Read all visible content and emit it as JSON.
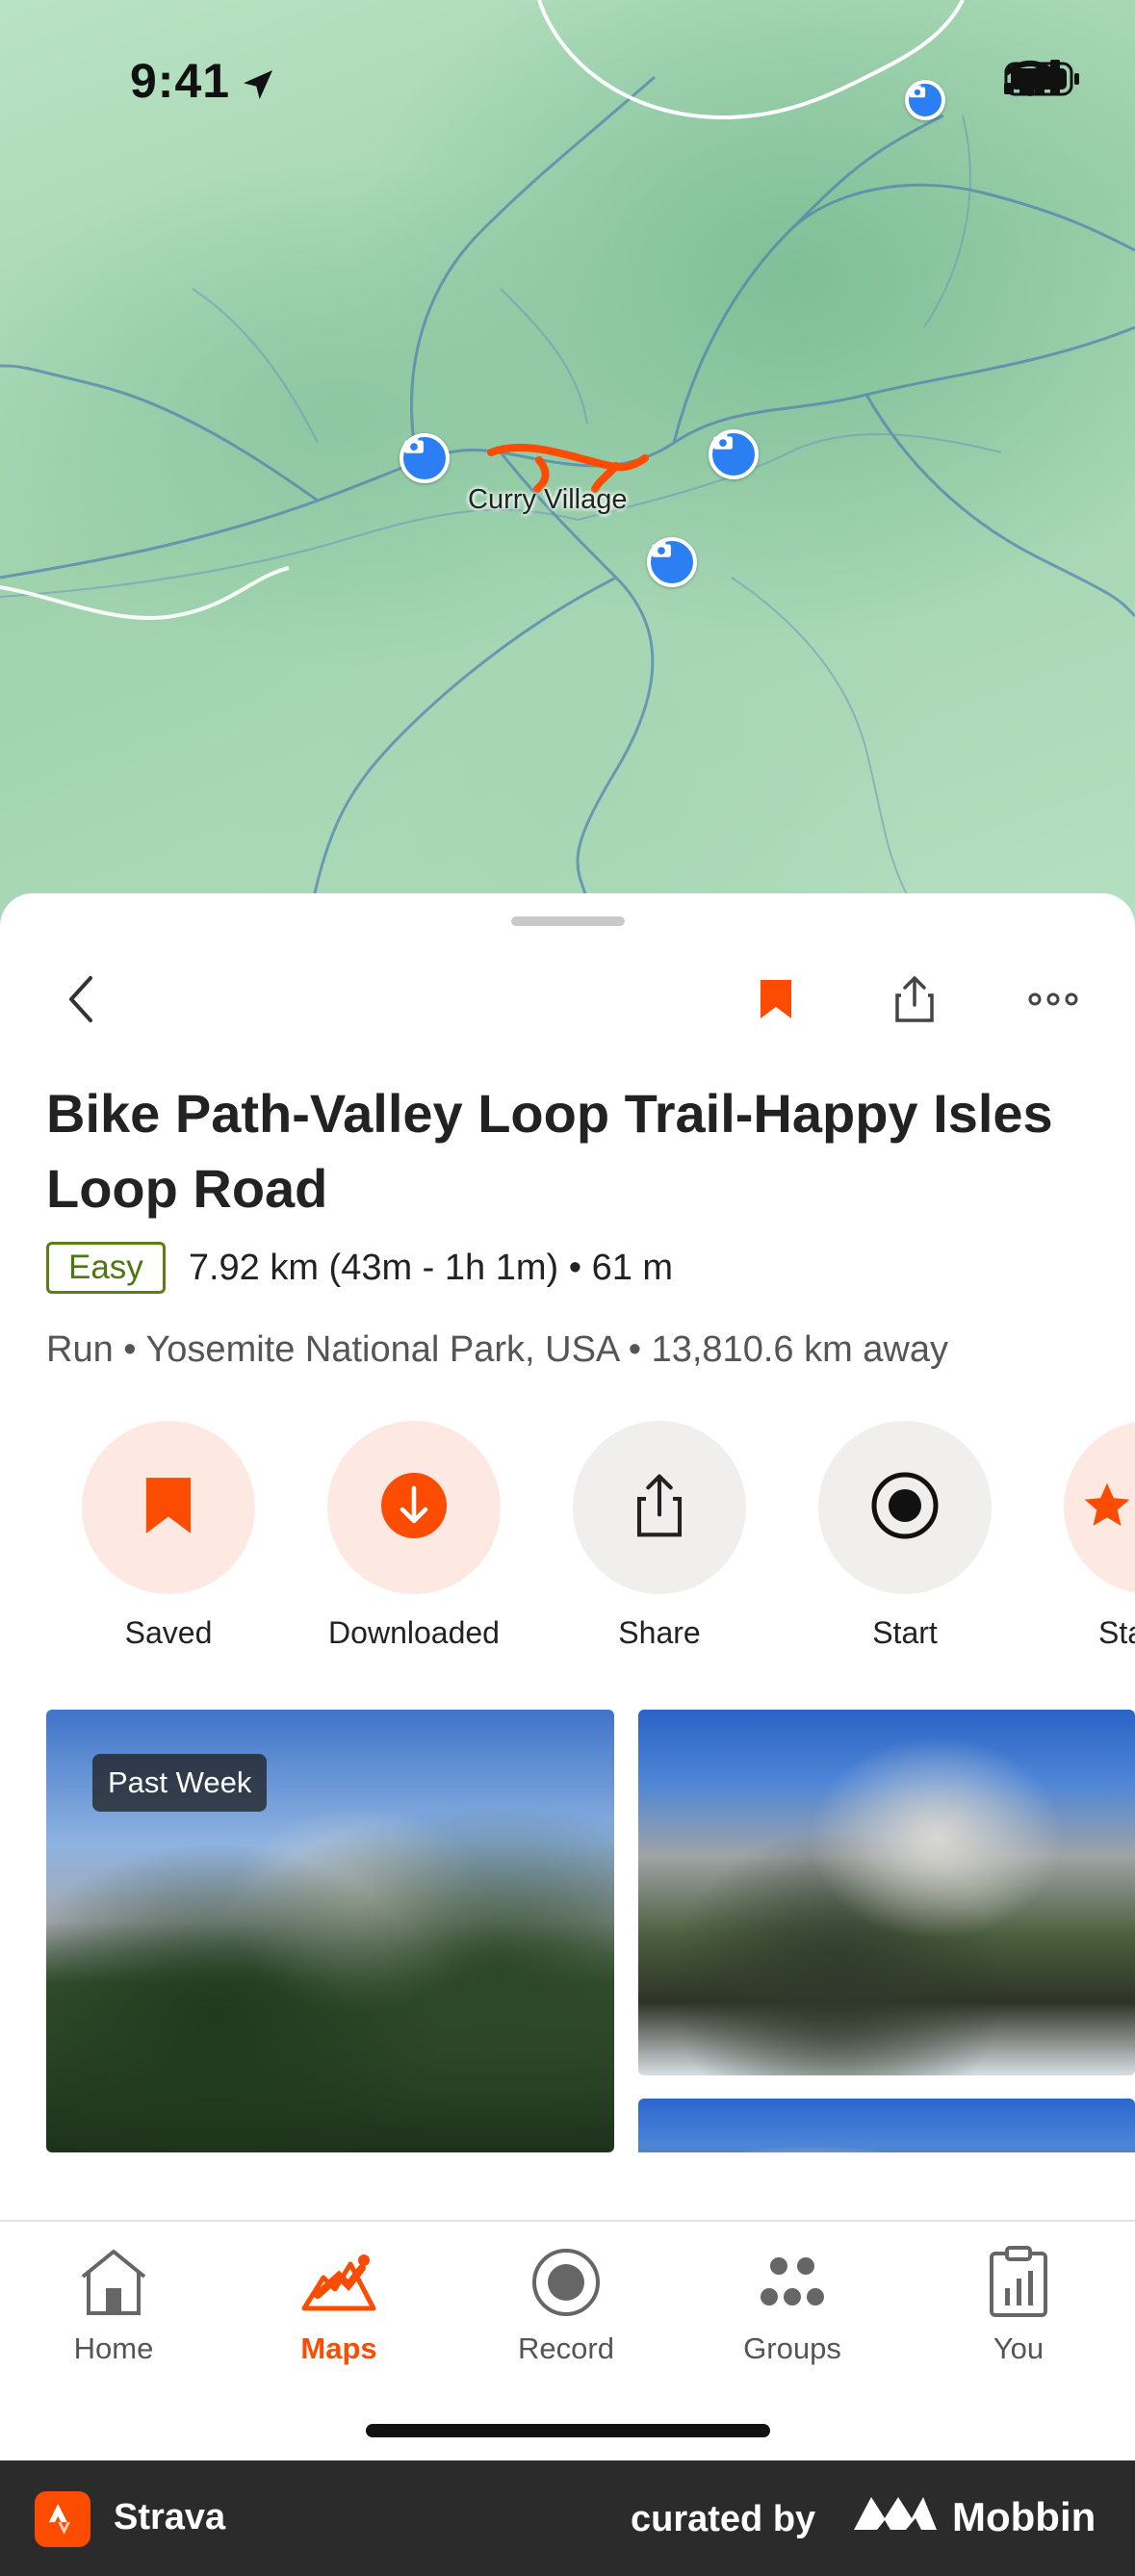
{
  "status_bar": {
    "time": "9:41"
  },
  "map": {
    "place_label": "Curry Village"
  },
  "toolbar": {
    "back_icon": "chevron-left-icon",
    "bookmark_icon": "bookmark-icon",
    "share_icon": "share-icon",
    "more_icon": "ellipsis-icon",
    "bookmark_color": "#fc4c02"
  },
  "route": {
    "title": "Bike Path-Valley Loop Trail-Happy Isles Loop Road",
    "difficulty": "Easy",
    "stats": "7.92 km (43m - 1h 1m) • 61 m",
    "location": "Run • Yosemite National Park, USA • 13,810.6 km away"
  },
  "actions": [
    {
      "label": "Saved",
      "icon": "bookmark-icon"
    },
    {
      "label": "Downloaded",
      "icon": "download-icon"
    },
    {
      "label": "Share",
      "icon": "share-icon"
    },
    {
      "label": "Start",
      "icon": "record-icon"
    },
    {
      "label": "Sta",
      "icon": "star-icon"
    }
  ],
  "photos": {
    "badge": "Past Week"
  },
  "tabs": [
    {
      "label": "Home",
      "icon": "home-icon"
    },
    {
      "label": "Maps",
      "icon": "maps-icon",
      "active": true
    },
    {
      "label": "Record",
      "icon": "record-icon"
    },
    {
      "label": "Groups",
      "icon": "groups-icon"
    },
    {
      "label": "You",
      "icon": "clipboard-chart-icon"
    }
  ],
  "footer": {
    "app_name": "Strava",
    "curated_by": "curated by",
    "brand": "Mobbin"
  },
  "colors": {
    "accent": "#fc4c02",
    "easy_badge": "#5b7f12",
    "route_line": "#fc4c02",
    "pin": "#2b7ff3"
  }
}
